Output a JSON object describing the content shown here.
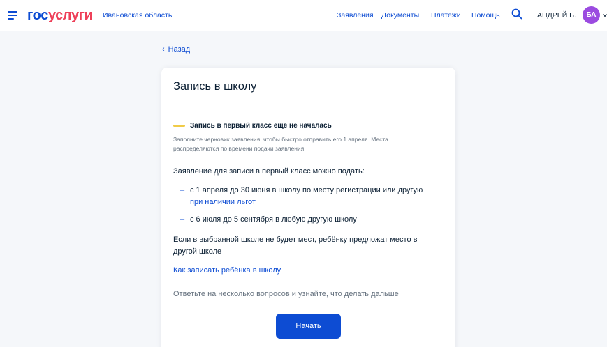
{
  "header": {
    "logo_part1": "гос",
    "logo_part2": "услуги",
    "region": "Ивановская область",
    "nav": [
      {
        "label": "Заявления"
      },
      {
        "label": "Документы"
      },
      {
        "label": "Платежи"
      },
      {
        "label": "Помощь"
      }
    ],
    "user_name": "АНДРЕЙ Б.",
    "avatar_initials": "БА",
    "accent_color": "#0d4cd3",
    "avatar_color": "#9b4be0"
  },
  "back_label": "Назад",
  "card": {
    "title": "Запись в школу",
    "status": {
      "text": "Запись в первый класс ещё не началась",
      "color": "#f0cb47",
      "description": "Заполните черновик заявления, чтобы быстро отправить его 1 апреля. Места распределяются по времени подачи заявления"
    },
    "intro": "Заявление для записи в первый класс можно подать:",
    "bullets": [
      {
        "text": "с 1 апреля до 30 июня в школу по месту регистрации или другую",
        "link": "при наличии льгот"
      },
      {
        "text": "с 6 июля до 5 сентября в любую другую школу",
        "link": ""
      }
    ],
    "note": "Если в выбранной школе не будет мест, ребёнку предложат место в другой школе",
    "howto_link": "Как записать ребёнка в школу",
    "hint": "Ответьте на несколько вопросов и узнайте, что делать дальше",
    "start_button": "Начать"
  }
}
